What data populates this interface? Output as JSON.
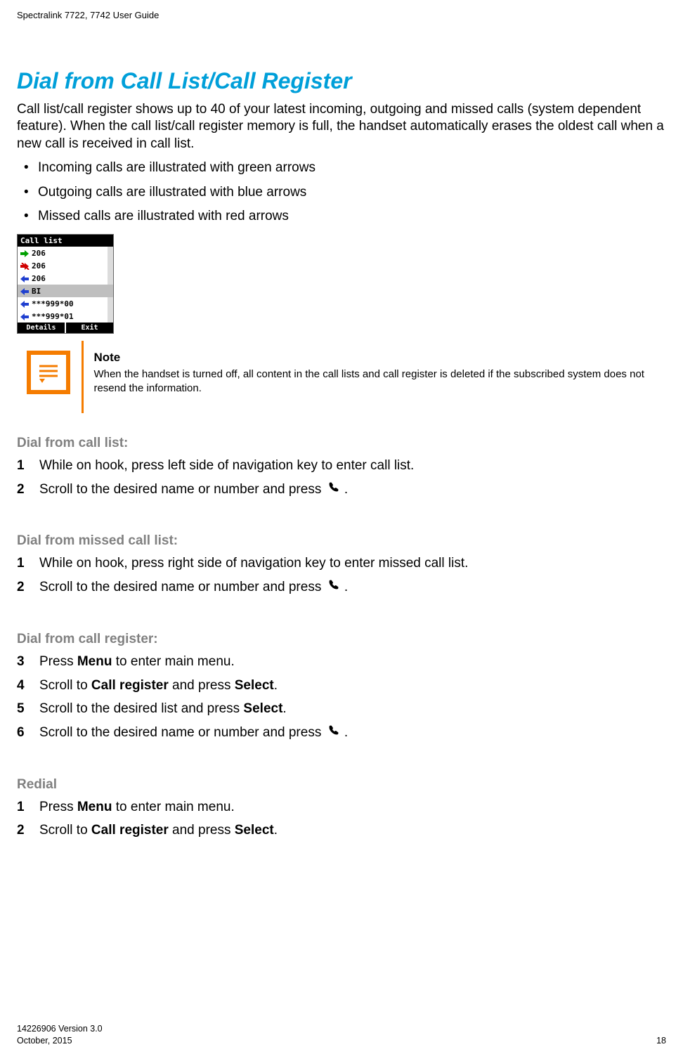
{
  "header": {
    "line": "Spectralink 7722, 7742  User Guide"
  },
  "heading": "Dial from Call List/Call Register",
  "intro": "Call list/call register shows up to 40 of your latest incoming, outgoing and missed calls (system dependent feature). When the call list/call register memory is full, the handset automatically erases the oldest call when a new call is received in call list.",
  "bullets": [
    "Incoming calls are illustrated with green arrows",
    "Outgoing calls are illustrated with blue arrows",
    "Missed calls are illustrated with red arrows"
  ],
  "phone_screenshot": {
    "title": "Call list",
    "rows": [
      {
        "arrow": "green-right",
        "text": "206",
        "selected": false
      },
      {
        "arrow": "red-right-crossed",
        "text": "206",
        "selected": false
      },
      {
        "arrow": "blue-left",
        "text": "206",
        "selected": false
      },
      {
        "arrow": "blue-left",
        "text": "BI",
        "selected": true
      },
      {
        "arrow": "blue-left",
        "text": "***999*00",
        "selected": false
      },
      {
        "arrow": "blue-left",
        "text": "***999*01",
        "selected": false
      }
    ],
    "softkeys": {
      "left": "Details",
      "right": "Exit"
    }
  },
  "note": {
    "title": "Note",
    "body": "When the handset is turned off, all content in the call lists and call register is deleted if the subscribed system does not resend the information."
  },
  "sections": [
    {
      "title": "Dial from call list:",
      "start": 1,
      "steps": [
        {
          "pre": "While on hook, press left side of navigation key to enter call list.",
          "icon": false,
          "post": ""
        },
        {
          "pre": "Scroll to the desired name or number and press ",
          "icon": true,
          "post": " ."
        }
      ]
    },
    {
      "title": "Dial from missed call list:",
      "start": 1,
      "steps": [
        {
          "pre": "While on hook, press right side of navigation key to enter missed call list.",
          "icon": false,
          "post": ""
        },
        {
          "pre": "Scroll to the desired name or number and press ",
          "icon": true,
          "post": " ."
        }
      ]
    },
    {
      "title": "Dial from call register:",
      "start": 3,
      "steps": [
        {
          "pre": "Press ",
          "bold1": "Menu",
          "mid": " to enter main menu.",
          "icon": false
        },
        {
          "pre": "Scroll to ",
          "bold1": "Call register",
          "mid": " and press ",
          "bold2": "Select",
          "post": ".",
          "icon": false
        },
        {
          "pre": "Scroll to the desired list and press ",
          "bold1": "Select",
          "mid": ".",
          "icon": false
        },
        {
          "pre": "Scroll to the desired name or number and press ",
          "icon": true,
          "post": " ."
        }
      ]
    },
    {
      "title": "Redial",
      "start": 1,
      "steps": [
        {
          "pre": "Press ",
          "bold1": "Menu",
          "mid": " to enter main menu.",
          "icon": false
        },
        {
          "pre": "Scroll to ",
          "bold1": "Call register",
          "mid": " and press ",
          "bold2": "Select",
          "post": ".",
          "icon": false
        }
      ]
    }
  ],
  "footer": {
    "left_line1": "14226906 Version 3.0",
    "left_line2": "October, 2015",
    "right": "18"
  }
}
